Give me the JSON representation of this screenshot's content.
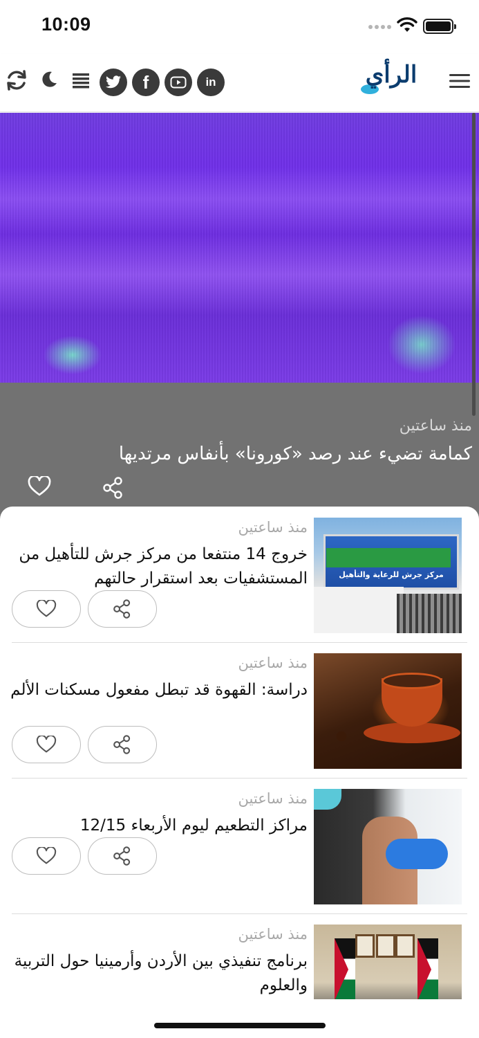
{
  "status_bar": {
    "time": "10:09"
  },
  "header": {
    "logo_text": "الرأي",
    "icons": [
      "refresh-icon",
      "moon-icon",
      "list-icon",
      "twitter-icon",
      "facebook-icon",
      "youtube-icon",
      "linkedin-icon",
      "hamburger-menu-icon"
    ],
    "linkedin_label": "in",
    "facebook_label": "f"
  },
  "hero": {
    "time": "منذ ساعتين",
    "title": "كمامة تضيء عند رصد «كورونا» بأنفاس مرتديها"
  },
  "articles": [
    {
      "time": "منذ ساعتين",
      "title": "خروج 14 منتفعا من مركز جرش للتأهيل من المستشفيات بعد استقرار حالتهم",
      "thumb_sign_text": "مركز جرش للرعاية والتأهيل"
    },
    {
      "time": "منذ ساعتين",
      "title": "دراسة: القهوة قد تبطل مفعول مسكنات الألم"
    },
    {
      "time": "منذ ساعتين",
      "title": "مراكز التطعيم ليوم الأربعاء 12/15"
    },
    {
      "time": "منذ ساعتين",
      "title": "برنامج تنفيذي بين الأردن وأرمينيا حول التربية والعلوم"
    }
  ],
  "colors": {
    "hero_overlay": "#727272",
    "social_icon_bg": "#3a3a3a",
    "muted_text": "#a8a8a8",
    "logo_blue": "#0b3c6e"
  }
}
